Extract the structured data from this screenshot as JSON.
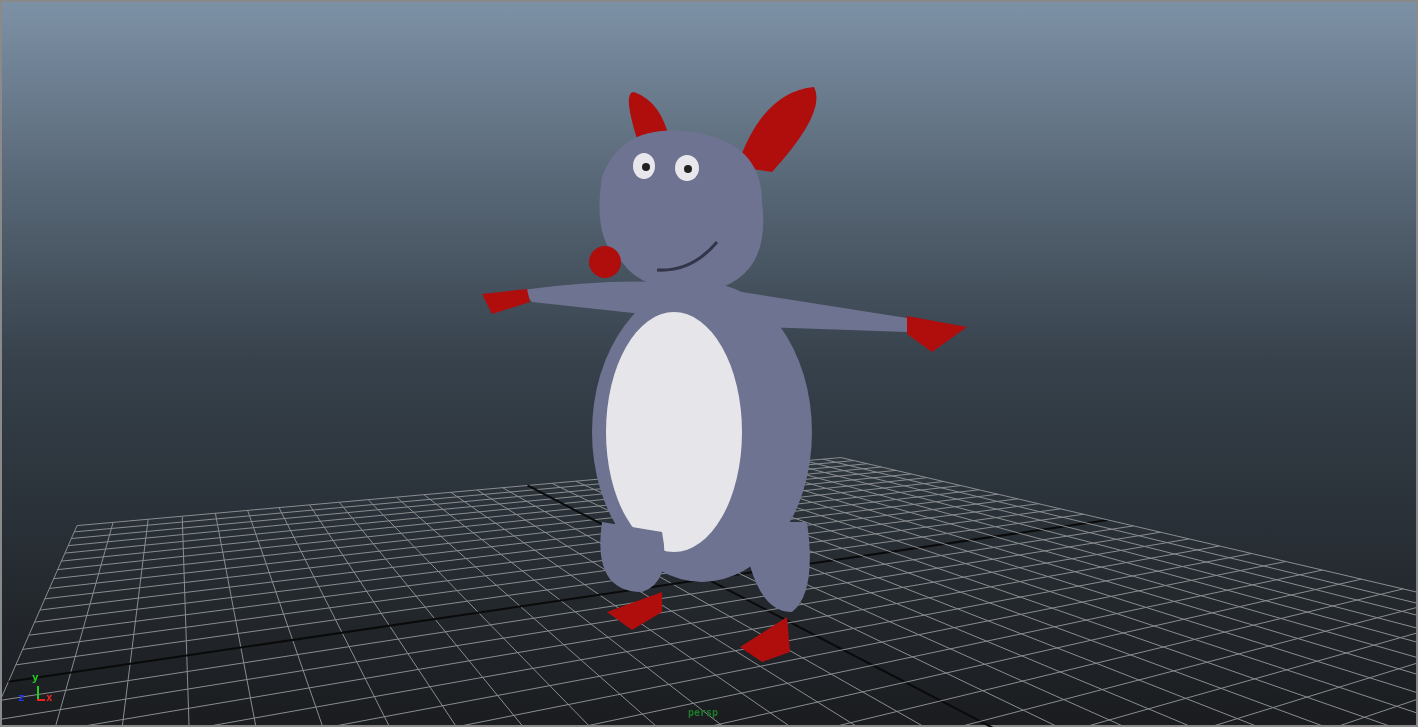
{
  "viewport": {
    "camera_label": "persp",
    "axis_labels": [
      {
        "text": "y",
        "color": "#22cc22"
      },
      {
        "text": "x",
        "color": "#ee2222"
      },
      {
        "text": "z",
        "color": "#2233ee"
      }
    ]
  }
}
